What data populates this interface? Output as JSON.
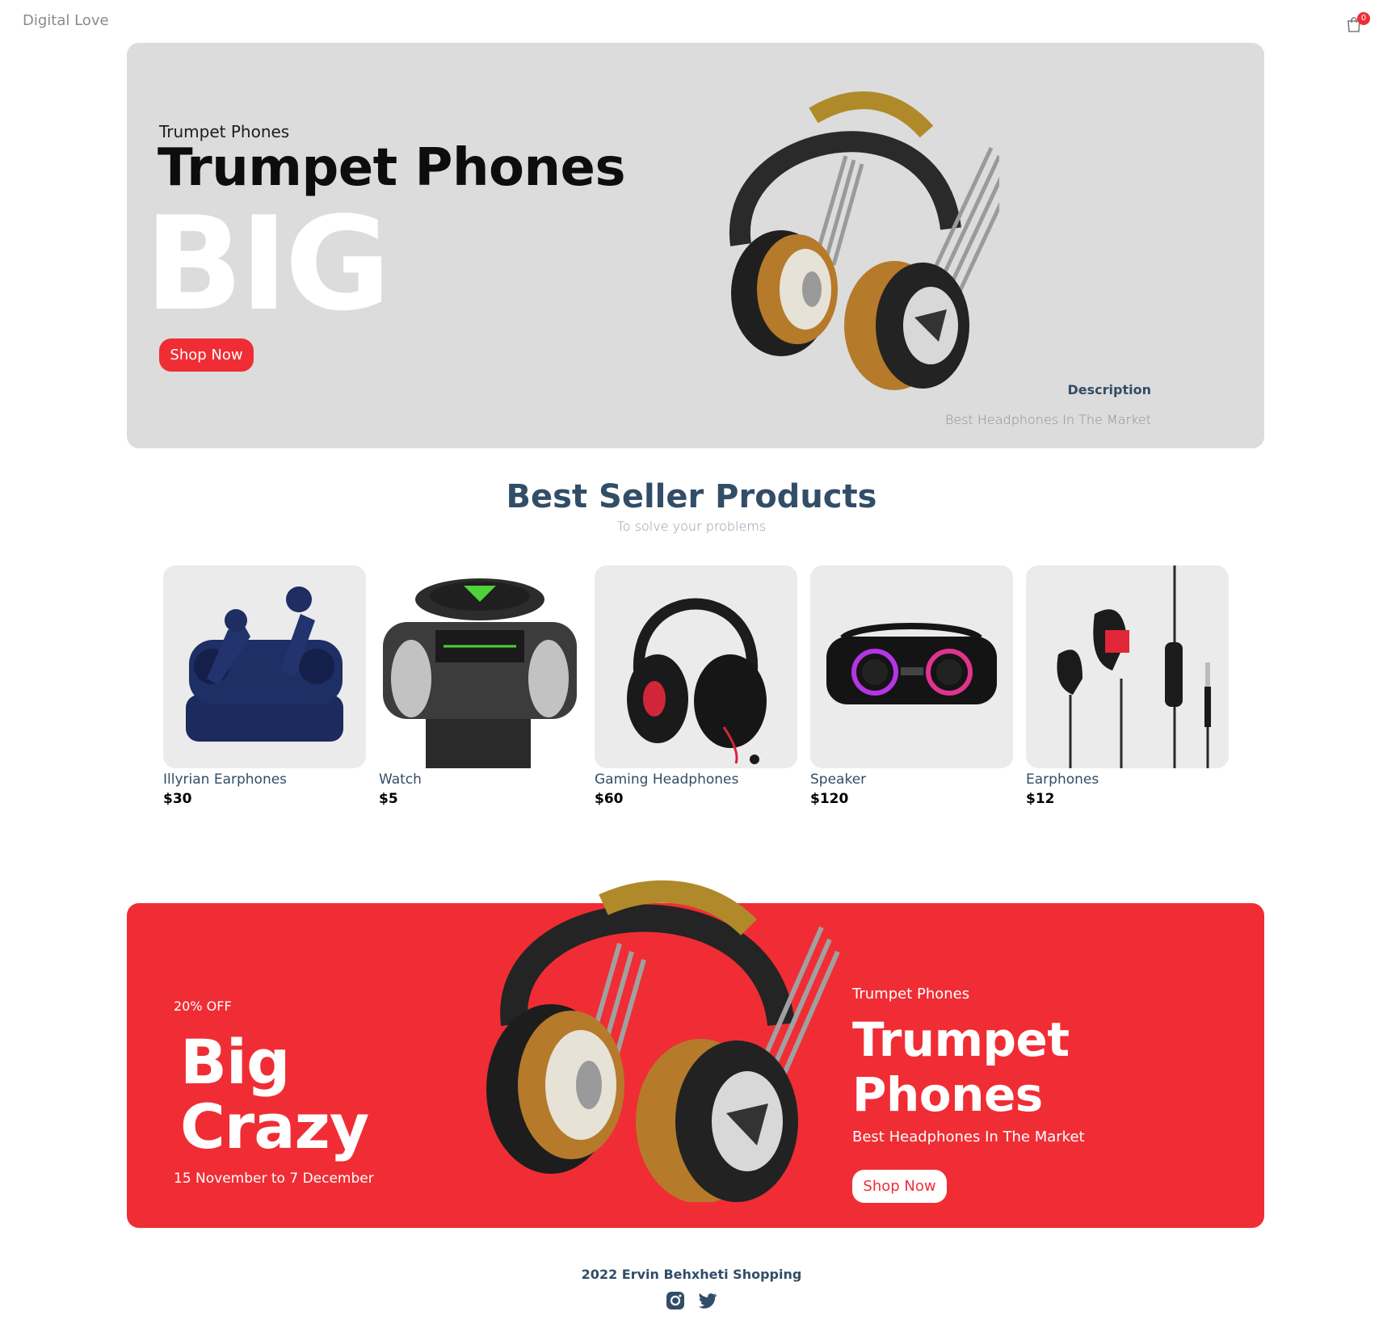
{
  "navbar": {
    "logo": "Digital Love",
    "cart_qty": "0",
    "cart_icon": "shopping-bag-icon"
  },
  "hero": {
    "small_text": "Trumpet Phones",
    "mid_text": "Trumpet Phones",
    "large_text": "BIG",
    "button_label": "Shop Now",
    "desc_title": "Description",
    "desc_text": "Best Headphones In The Market",
    "image": "trumpet-headphones-image"
  },
  "products_heading": {
    "title": "Best Seller Products",
    "subtitle": "To solve your problems"
  },
  "products": [
    {
      "name": "Illyrian Earphones",
      "price": "$30",
      "image": "earbuds-image"
    },
    {
      "name": "Watch",
      "price": "$5",
      "image": "watch-image"
    },
    {
      "name": "Gaming Headphones",
      "price": "$60",
      "image": "gaming-headphones-image"
    },
    {
      "name": "Speaker",
      "price": "$120",
      "image": "speaker-image"
    },
    {
      "name": "Earphones",
      "price": "$12",
      "image": "earphones-image"
    }
  ],
  "footer_banner": {
    "discount": "20% OFF",
    "large1": "Big",
    "large2": "Crazy",
    "sale_time": "15 November to 7 December",
    "small_text": "Trumpet Phones",
    "mid_text": "Trumpet Phones",
    "desc": "Best Headphones In The Market",
    "button_label": "Shop Now"
  },
  "footer": {
    "text": "2022 Ervin Behxheti Shopping",
    "icons": [
      "instagram-icon",
      "twitter-icon"
    ]
  },
  "colors": {
    "accent": "#f02d34",
    "text": "#324d67",
    "hero_bg": "#dcdcdc",
    "card_bg": "#ebebeb"
  }
}
